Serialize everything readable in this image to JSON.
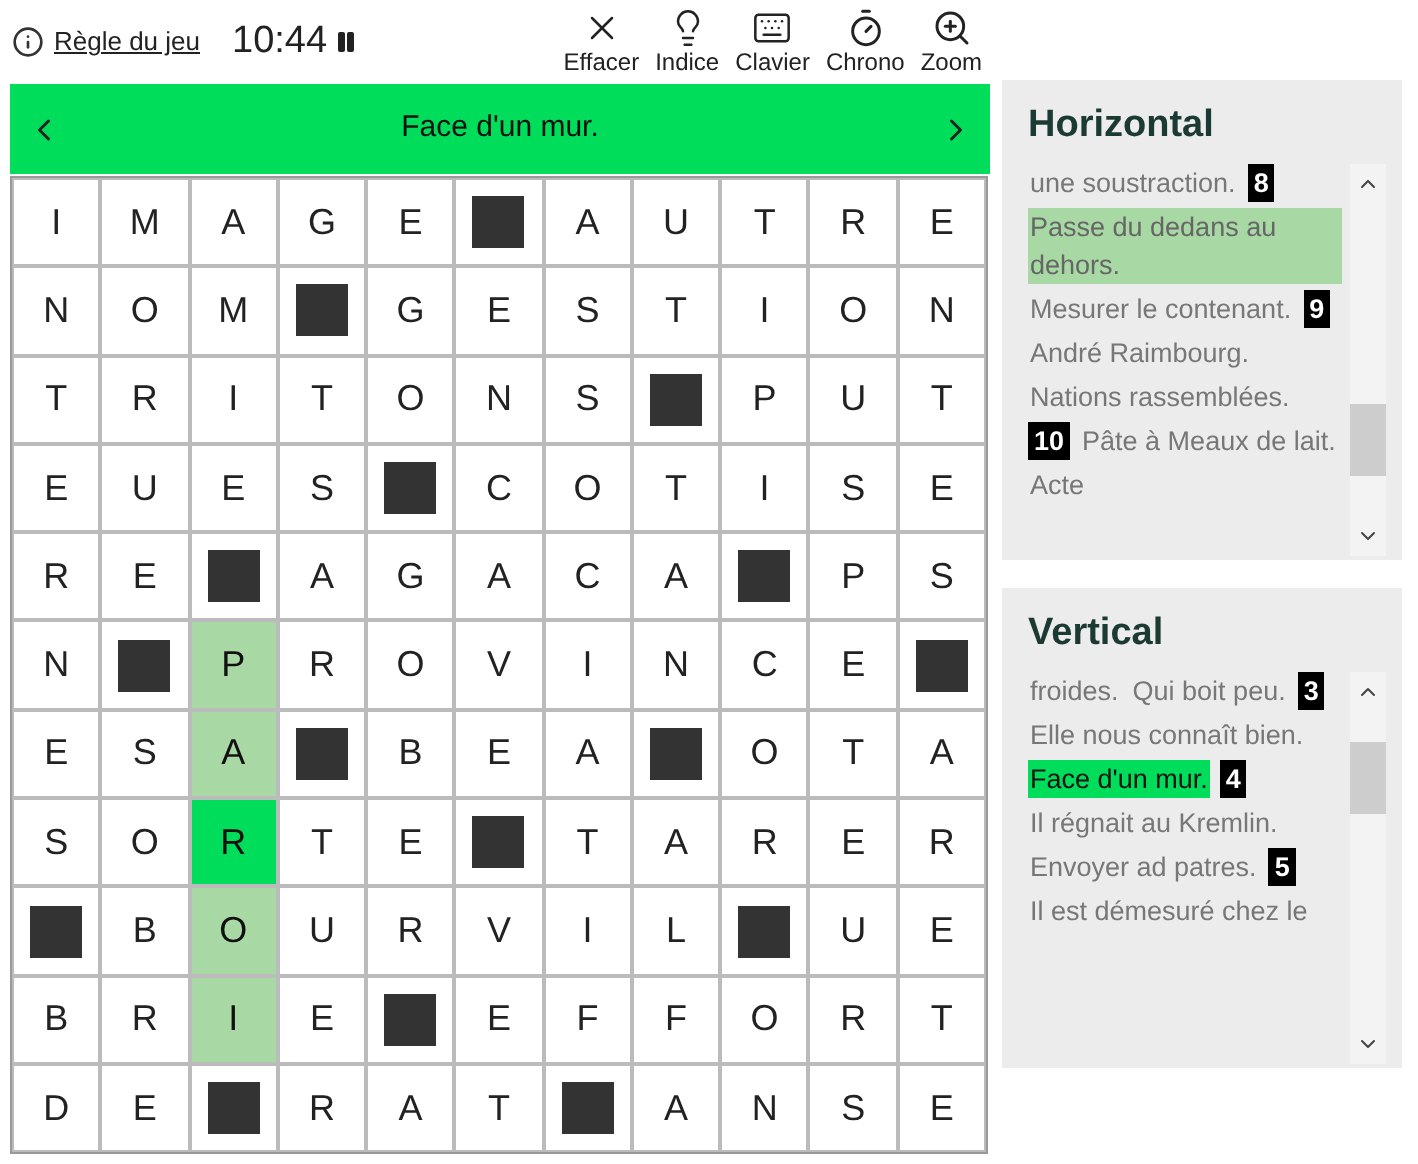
{
  "toolbar": {
    "rules_link": "Règle du jeu",
    "timer": "10:44",
    "paused": false,
    "tools": [
      {
        "kind": "erase",
        "label": "Effacer"
      },
      {
        "kind": "hint",
        "label": "Indice"
      },
      {
        "kind": "keyboard",
        "label": "Clavier"
      },
      {
        "kind": "chrono",
        "label": "Chrono"
      },
      {
        "kind": "zoom",
        "label": "Zoom"
      }
    ]
  },
  "clue_bar": {
    "text": "Face d'un mur."
  },
  "grid": {
    "rows": [
      [
        {
          "kind": "letter",
          "letter": "I",
          "in_word": false,
          "selected": false
        },
        {
          "kind": "letter",
          "letter": "M",
          "in_word": false,
          "selected": false
        },
        {
          "kind": "letter",
          "letter": "A",
          "in_word": false,
          "selected": false
        },
        {
          "kind": "letter",
          "letter": "G",
          "in_word": false,
          "selected": false
        },
        {
          "kind": "letter",
          "letter": "E",
          "in_word": false,
          "selected": false
        },
        {
          "kind": "block"
        },
        {
          "kind": "letter",
          "letter": "A",
          "in_word": false,
          "selected": false
        },
        {
          "kind": "letter",
          "letter": "U",
          "in_word": false,
          "selected": false
        },
        {
          "kind": "letter",
          "letter": "T",
          "in_word": false,
          "selected": false
        },
        {
          "kind": "letter",
          "letter": "R",
          "in_word": false,
          "selected": false
        },
        {
          "kind": "letter",
          "letter": "E",
          "in_word": false,
          "selected": false
        }
      ],
      [
        {
          "kind": "letter",
          "letter": "N",
          "in_word": false,
          "selected": false
        },
        {
          "kind": "letter",
          "letter": "O",
          "in_word": false,
          "selected": false
        },
        {
          "kind": "letter",
          "letter": "M",
          "in_word": false,
          "selected": false
        },
        {
          "kind": "block"
        },
        {
          "kind": "letter",
          "letter": "G",
          "in_word": false,
          "selected": false
        },
        {
          "kind": "letter",
          "letter": "E",
          "in_word": false,
          "selected": false
        },
        {
          "kind": "letter",
          "letter": "S",
          "in_word": false,
          "selected": false
        },
        {
          "kind": "letter",
          "letter": "T",
          "in_word": false,
          "selected": false
        },
        {
          "kind": "letter",
          "letter": "I",
          "in_word": false,
          "selected": false
        },
        {
          "kind": "letter",
          "letter": "O",
          "in_word": false,
          "selected": false
        },
        {
          "kind": "letter",
          "letter": "N",
          "in_word": false,
          "selected": false
        }
      ],
      [
        {
          "kind": "letter",
          "letter": "T",
          "in_word": false,
          "selected": false
        },
        {
          "kind": "letter",
          "letter": "R",
          "in_word": false,
          "selected": false
        },
        {
          "kind": "letter",
          "letter": "I",
          "in_word": false,
          "selected": false
        },
        {
          "kind": "letter",
          "letter": "T",
          "in_word": false,
          "selected": false
        },
        {
          "kind": "letter",
          "letter": "O",
          "in_word": false,
          "selected": false
        },
        {
          "kind": "letter",
          "letter": "N",
          "in_word": false,
          "selected": false
        },
        {
          "kind": "letter",
          "letter": "S",
          "in_word": false,
          "selected": false
        },
        {
          "kind": "block"
        },
        {
          "kind": "letter",
          "letter": "P",
          "in_word": false,
          "selected": false
        },
        {
          "kind": "letter",
          "letter": "U",
          "in_word": false,
          "selected": false
        },
        {
          "kind": "letter",
          "letter": "T",
          "in_word": false,
          "selected": false
        }
      ],
      [
        {
          "kind": "letter",
          "letter": "E",
          "in_word": false,
          "selected": false
        },
        {
          "kind": "letter",
          "letter": "U",
          "in_word": false,
          "selected": false
        },
        {
          "kind": "letter",
          "letter": "E",
          "in_word": false,
          "selected": false
        },
        {
          "kind": "letter",
          "letter": "S",
          "in_word": false,
          "selected": false
        },
        {
          "kind": "block"
        },
        {
          "kind": "letter",
          "letter": "C",
          "in_word": false,
          "selected": false
        },
        {
          "kind": "letter",
          "letter": "O",
          "in_word": false,
          "selected": false
        },
        {
          "kind": "letter",
          "letter": "T",
          "in_word": false,
          "selected": false
        },
        {
          "kind": "letter",
          "letter": "I",
          "in_word": false,
          "selected": false
        },
        {
          "kind": "letter",
          "letter": "S",
          "in_word": false,
          "selected": false
        },
        {
          "kind": "letter",
          "letter": "E",
          "in_word": false,
          "selected": false
        }
      ],
      [
        {
          "kind": "letter",
          "letter": "R",
          "in_word": false,
          "selected": false
        },
        {
          "kind": "letter",
          "letter": "E",
          "in_word": false,
          "selected": false
        },
        {
          "kind": "block"
        },
        {
          "kind": "letter",
          "letter": "A",
          "in_word": false,
          "selected": false
        },
        {
          "kind": "letter",
          "letter": "G",
          "in_word": false,
          "selected": false
        },
        {
          "kind": "letter",
          "letter": "A",
          "in_word": false,
          "selected": false
        },
        {
          "kind": "letter",
          "letter": "C",
          "in_word": false,
          "selected": false
        },
        {
          "kind": "letter",
          "letter": "A",
          "in_word": false,
          "selected": false
        },
        {
          "kind": "block"
        },
        {
          "kind": "letter",
          "letter": "P",
          "in_word": false,
          "selected": false
        },
        {
          "kind": "letter",
          "letter": "S",
          "in_word": false,
          "selected": false
        }
      ],
      [
        {
          "kind": "letter",
          "letter": "N",
          "in_word": false,
          "selected": false
        },
        {
          "kind": "block"
        },
        {
          "kind": "letter",
          "letter": "P",
          "in_word": true,
          "selected": false
        },
        {
          "kind": "letter",
          "letter": "R",
          "in_word": false,
          "selected": false
        },
        {
          "kind": "letter",
          "letter": "O",
          "in_word": false,
          "selected": false
        },
        {
          "kind": "letter",
          "letter": "V",
          "in_word": false,
          "selected": false
        },
        {
          "kind": "letter",
          "letter": "I",
          "in_word": false,
          "selected": false
        },
        {
          "kind": "letter",
          "letter": "N",
          "in_word": false,
          "selected": false
        },
        {
          "kind": "letter",
          "letter": "C",
          "in_word": false,
          "selected": false
        },
        {
          "kind": "letter",
          "letter": "E",
          "in_word": false,
          "selected": false
        },
        {
          "kind": "block"
        }
      ],
      [
        {
          "kind": "letter",
          "letter": "E",
          "in_word": false,
          "selected": false
        },
        {
          "kind": "letter",
          "letter": "S",
          "in_word": false,
          "selected": false
        },
        {
          "kind": "letter",
          "letter": "A",
          "in_word": true,
          "selected": false
        },
        {
          "kind": "block"
        },
        {
          "kind": "letter",
          "letter": "B",
          "in_word": false,
          "selected": false
        },
        {
          "kind": "letter",
          "letter": "E",
          "in_word": false,
          "selected": false
        },
        {
          "kind": "letter",
          "letter": "A",
          "in_word": false,
          "selected": false
        },
        {
          "kind": "block"
        },
        {
          "kind": "letter",
          "letter": "O",
          "in_word": false,
          "selected": false
        },
        {
          "kind": "letter",
          "letter": "T",
          "in_word": false,
          "selected": false
        },
        {
          "kind": "letter",
          "letter": "A",
          "in_word": false,
          "selected": false
        }
      ],
      [
        {
          "kind": "letter",
          "letter": "S",
          "in_word": false,
          "selected": false
        },
        {
          "kind": "letter",
          "letter": "O",
          "in_word": false,
          "selected": false
        },
        {
          "kind": "letter",
          "letter": "R",
          "in_word": true,
          "selected": true
        },
        {
          "kind": "letter",
          "letter": "T",
          "in_word": false,
          "selected": false
        },
        {
          "kind": "letter",
          "letter": "E",
          "in_word": false,
          "selected": false
        },
        {
          "kind": "block"
        },
        {
          "kind": "letter",
          "letter": "T",
          "in_word": false,
          "selected": false
        },
        {
          "kind": "letter",
          "letter": "A",
          "in_word": false,
          "selected": false
        },
        {
          "kind": "letter",
          "letter": "R",
          "in_word": false,
          "selected": false
        },
        {
          "kind": "letter",
          "letter": "E",
          "in_word": false,
          "selected": false
        },
        {
          "kind": "letter",
          "letter": "R",
          "in_word": false,
          "selected": false
        }
      ],
      [
        {
          "kind": "block"
        },
        {
          "kind": "letter",
          "letter": "B",
          "in_word": false,
          "selected": false
        },
        {
          "kind": "letter",
          "letter": "O",
          "in_word": true,
          "selected": false
        },
        {
          "kind": "letter",
          "letter": "U",
          "in_word": false,
          "selected": false
        },
        {
          "kind": "letter",
          "letter": "R",
          "in_word": false,
          "selected": false
        },
        {
          "kind": "letter",
          "letter": "V",
          "in_word": false,
          "selected": false
        },
        {
          "kind": "letter",
          "letter": "I",
          "in_word": false,
          "selected": false
        },
        {
          "kind": "letter",
          "letter": "L",
          "in_word": false,
          "selected": false
        },
        {
          "kind": "block"
        },
        {
          "kind": "letter",
          "letter": "U",
          "in_word": false,
          "selected": false
        },
        {
          "kind": "letter",
          "letter": "E",
          "in_word": false,
          "selected": false
        }
      ],
      [
        {
          "kind": "letter",
          "letter": "B",
          "in_word": false,
          "selected": false
        },
        {
          "kind": "letter",
          "letter": "R",
          "in_word": false,
          "selected": false
        },
        {
          "kind": "letter",
          "letter": "I",
          "in_word": true,
          "selected": false
        },
        {
          "kind": "letter",
          "letter": "E",
          "in_word": false,
          "selected": false
        },
        {
          "kind": "block"
        },
        {
          "kind": "letter",
          "letter": "E",
          "in_word": false,
          "selected": false
        },
        {
          "kind": "letter",
          "letter": "F",
          "in_word": false,
          "selected": false
        },
        {
          "kind": "letter",
          "letter": "F",
          "in_word": false,
          "selected": false
        },
        {
          "kind": "letter",
          "letter": "O",
          "in_word": false,
          "selected": false
        },
        {
          "kind": "letter",
          "letter": "R",
          "in_word": false,
          "selected": false
        },
        {
          "kind": "letter",
          "letter": "T",
          "in_word": false,
          "selected": false
        }
      ],
      [
        {
          "kind": "letter",
          "letter": "D",
          "in_word": false,
          "selected": false
        },
        {
          "kind": "letter",
          "letter": "E",
          "in_word": false,
          "selected": false
        },
        {
          "kind": "block"
        },
        {
          "kind": "letter",
          "letter": "R",
          "in_word": false,
          "selected": false
        },
        {
          "kind": "letter",
          "letter": "A",
          "in_word": false,
          "selected": false
        },
        {
          "kind": "letter",
          "letter": "T",
          "in_word": false,
          "selected": false
        },
        {
          "kind": "block"
        },
        {
          "kind": "letter",
          "letter": "A",
          "in_word": false,
          "selected": false
        },
        {
          "kind": "letter",
          "letter": "N",
          "in_word": false,
          "selected": false
        },
        {
          "kind": "letter",
          "letter": "S",
          "in_word": false,
          "selected": false
        },
        {
          "kind": "letter",
          "letter": "E",
          "in_word": false,
          "selected": false
        }
      ]
    ]
  },
  "clue_panels": [
    {
      "title": "Horizontal",
      "items": [
        {
          "kind": "clue",
          "text": "une soustraction.",
          "in_word": false,
          "selected": false
        },
        {
          "kind": "number",
          "text": "8"
        },
        {
          "kind": "clue",
          "text": "Passe du dedans au dehors.",
          "in_word": true,
          "selected": false
        },
        {
          "kind": "clue",
          "text": "Mesurer le contenant.",
          "in_word": false,
          "selected": false
        },
        {
          "kind": "number",
          "text": "9"
        },
        {
          "kind": "clue",
          "text": "André Raimbourg.",
          "in_word": false,
          "selected": false
        },
        {
          "kind": "clue",
          "text": "Nations rassemblées.",
          "in_word": false,
          "selected": false
        },
        {
          "kind": "number",
          "text": "10"
        },
        {
          "kind": "clue",
          "text": "Pâte à Meaux de lait.",
          "in_word": false,
          "selected": false
        },
        {
          "kind": "clue",
          "text": "Acte",
          "in_word": false,
          "selected": false
        }
      ]
    },
    {
      "title": "Vertical",
      "items": [
        {
          "kind": "clue",
          "text": "froides.",
          "in_word": false,
          "selected": false
        },
        {
          "kind": "clue",
          "text": "Qui boit peu.",
          "in_word": false,
          "selected": false
        },
        {
          "kind": "number",
          "text": "3"
        },
        {
          "kind": "clue",
          "text": "Elle nous connaît bien.",
          "in_word": false,
          "selected": false
        },
        {
          "kind": "clue",
          "text": "Face d'un mur.",
          "in_word": false,
          "selected": true
        },
        {
          "kind": "number",
          "text": "4"
        },
        {
          "kind": "clue",
          "text": "Il régnait au Kremlin.",
          "in_word": false,
          "selected": false
        },
        {
          "kind": "clue",
          "text": "Envoyer ad patres.",
          "in_word": false,
          "selected": false
        },
        {
          "kind": "number",
          "text": "5"
        },
        {
          "kind": "clue",
          "text": "Il est démesuré chez le",
          "in_word": false,
          "selected": false
        }
      ]
    }
  ]
}
